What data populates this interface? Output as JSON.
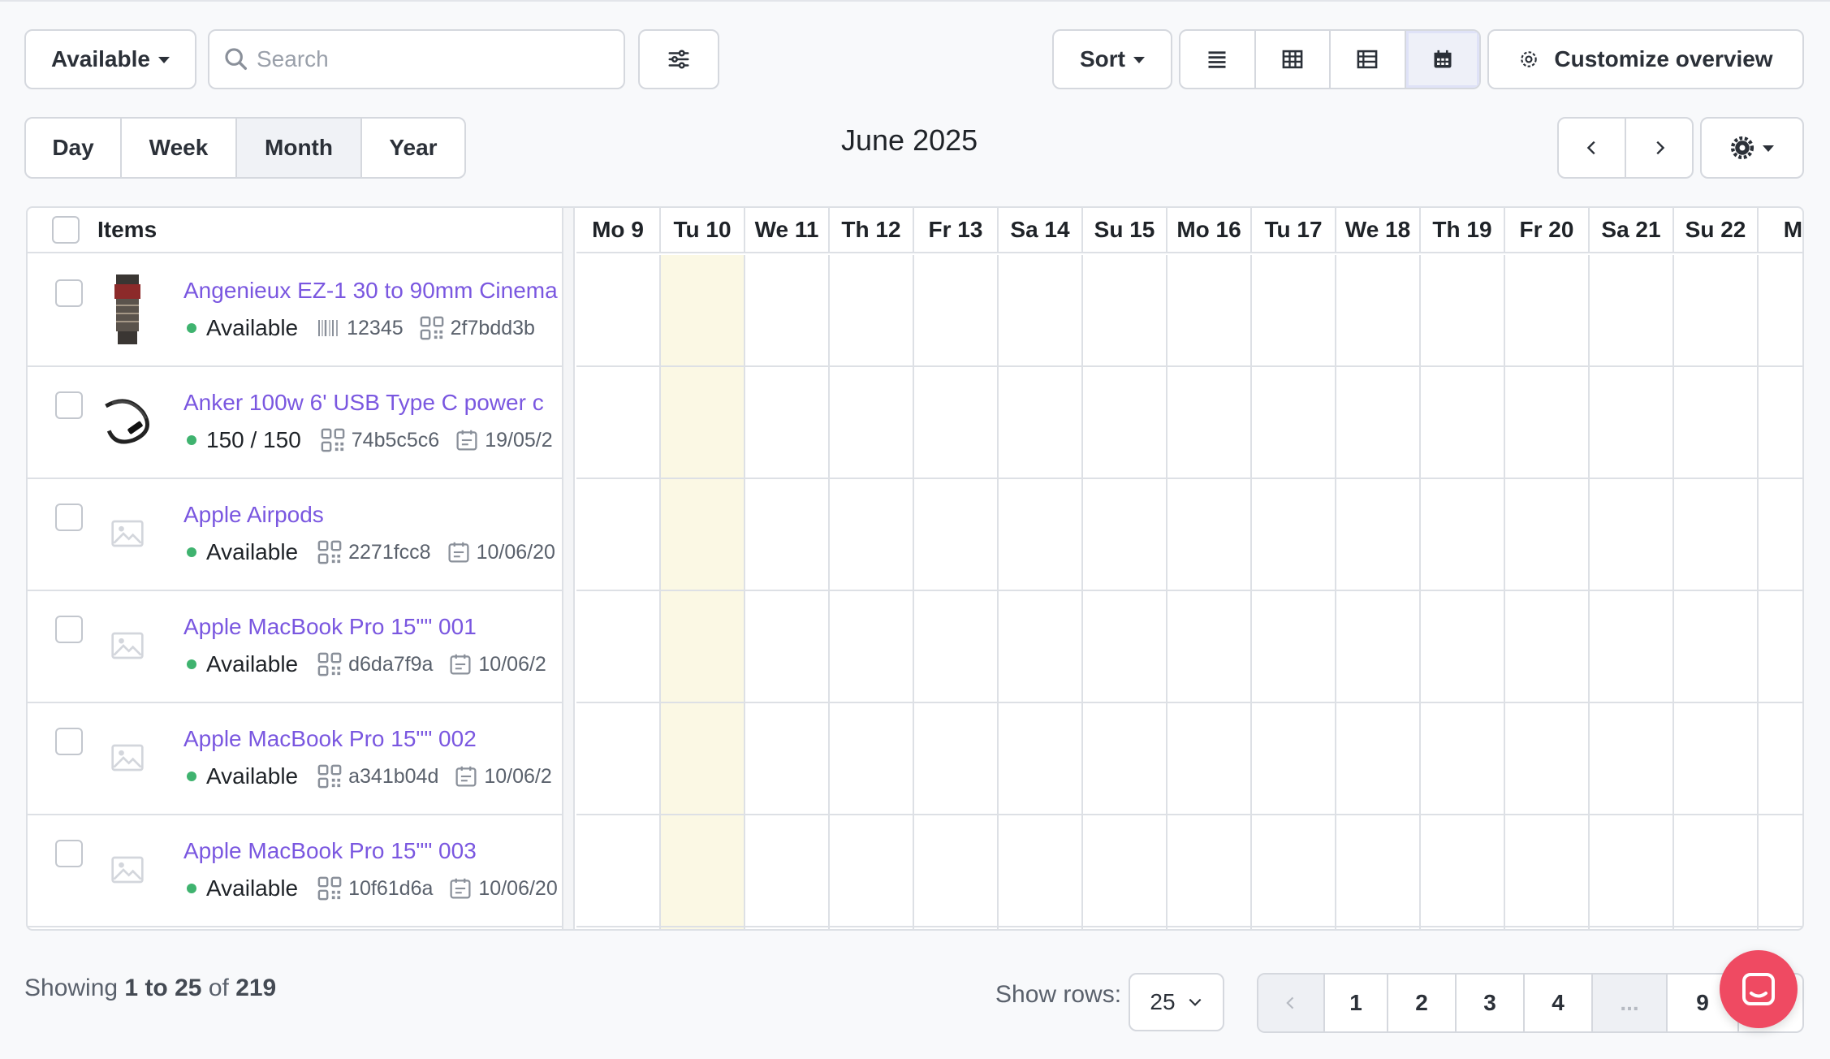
{
  "toolbar": {
    "available_label": "Available",
    "search_placeholder": "Search",
    "sort_label": "Sort",
    "customize_label": "Customize overview"
  },
  "periods": [
    {
      "label": "Day",
      "active": false
    },
    {
      "label": "Week",
      "active": false
    },
    {
      "label": "Month",
      "active": true
    },
    {
      "label": "Year",
      "active": false
    }
  ],
  "calendar": {
    "title": "June 2025",
    "today_index": 1,
    "days": [
      "Mo 9",
      "Tu 10",
      "We 11",
      "Th 12",
      "Fr 13",
      "Sa 14",
      "Su 15",
      "Mo 16",
      "Tu 17",
      "We 18",
      "Th 19",
      "Fr 20",
      "Sa 21",
      "Su 22",
      "Mo"
    ]
  },
  "table": {
    "items_header": "Items",
    "rows": [
      {
        "name": "Angenieux EZ-1 30 to 90mm Cinema",
        "status": "Available",
        "barcode": "12345",
        "qr": "2f7bdd3b",
        "date": "",
        "thumb": "lens-image"
      },
      {
        "name": "Anker 100w 6' USB Type C power c",
        "status": "150 / 150",
        "barcode": "",
        "qr": "74b5c5c6",
        "date": "19/05/2",
        "thumb": "cable-image"
      },
      {
        "name": "Apple Airpods",
        "status": "Available",
        "barcode": "",
        "qr": "2271fcc8",
        "date": "10/06/20",
        "thumb": "placeholder-image"
      },
      {
        "name": "Apple MacBook Pro 15\"\" 001",
        "status": "Available",
        "barcode": "",
        "qr": "d6da7f9a",
        "date": "10/06/2",
        "thumb": "placeholder-image"
      },
      {
        "name": "Apple MacBook Pro 15\"\" 002",
        "status": "Available",
        "barcode": "",
        "qr": "a341b04d",
        "date": "10/06/2",
        "thumb": "placeholder-image"
      },
      {
        "name": "Apple MacBook Pro 15\"\" 003",
        "status": "Available",
        "barcode": "",
        "qr": "10f61d6a",
        "date": "10/06/20",
        "thumb": "placeholder-image"
      }
    ]
  },
  "footer": {
    "showing_prefix": "Showing",
    "range": "1 to 25",
    "of_word": "of",
    "total": "219",
    "rows_label": "Show rows:",
    "rows_value": "25",
    "pages": [
      "1",
      "2",
      "3",
      "4",
      "...",
      "9"
    ]
  },
  "colors": {
    "accent": "#7a57e0",
    "today": "#fbf8e4",
    "status_dot": "#3fb36f",
    "chat": "#ef4a62"
  }
}
